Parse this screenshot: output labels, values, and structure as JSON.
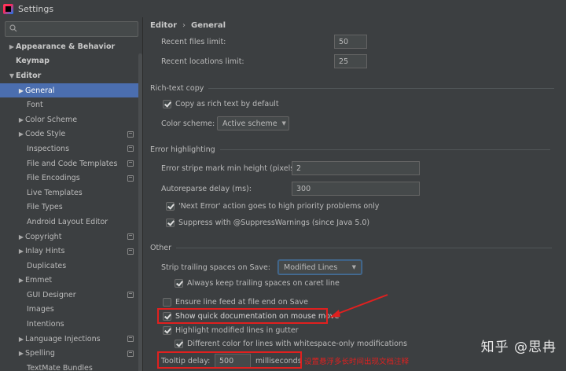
{
  "window": {
    "title": "Settings"
  },
  "sidebar": {
    "search_placeholder": "",
    "items": [
      {
        "label": "Appearance & Behavior"
      },
      {
        "label": "Keymap"
      },
      {
        "label": "Editor"
      },
      {
        "label": "General"
      },
      {
        "label": "Font"
      },
      {
        "label": "Color Scheme"
      },
      {
        "label": "Code Style"
      },
      {
        "label": "Inspections"
      },
      {
        "label": "File and Code Templates"
      },
      {
        "label": "File Encodings"
      },
      {
        "label": "Live Templates"
      },
      {
        "label": "File Types"
      },
      {
        "label": "Android Layout Editor"
      },
      {
        "label": "Copyright"
      },
      {
        "label": "Inlay Hints"
      },
      {
        "label": "Duplicates"
      },
      {
        "label": "Emmet"
      },
      {
        "label": "GUI Designer"
      },
      {
        "label": "Images"
      },
      {
        "label": "Intentions"
      },
      {
        "label": "Language Injections"
      },
      {
        "label": "Spelling"
      },
      {
        "label": "TextMate Bundles"
      }
    ]
  },
  "breadcrumb": {
    "parent": "Editor",
    "separator": "›",
    "current": "General"
  },
  "recent": {
    "files_label": "Recent files limit:",
    "files_value": "50",
    "locations_label": "Recent locations limit:",
    "locations_value": "25"
  },
  "rich_text": {
    "title": "Rich-text copy",
    "copy_label": "Copy as rich text by default",
    "scheme_label": "Color scheme:",
    "scheme_value": "Active scheme"
  },
  "error": {
    "title": "Error highlighting",
    "stripe_label": "Error stripe mark min height (pixels):",
    "stripe_value": "2",
    "reparse_label": "Autoreparse delay (ms):",
    "reparse_value": "300",
    "next_error_label": "'Next Error' action goes to high priority problems only",
    "suppress_label": "Suppress with @SuppressWarnings (since Java 5.0)"
  },
  "other": {
    "title": "Other",
    "strip_label": "Strip trailing spaces on Save:",
    "strip_value": "Modified Lines",
    "always_keep_label": "Always keep trailing spaces on caret line",
    "line_feed_label": "Ensure line feed at file end on Save",
    "quick_doc_label": "Show quick documentation on mouse move",
    "highlight_modified_label": "Highlight modified lines in gutter",
    "different_color_label": "Different color for lines with whitespace-only modifications",
    "tooltip_label": "Tooltip delay:",
    "tooltip_value": "500",
    "tooltip_unit": "milliseconds"
  },
  "annotation": {
    "text": "设置悬浮多长时间出现文档注释",
    "color": "#e0201f"
  },
  "watermark": {
    "text": "知乎 @思冉"
  }
}
